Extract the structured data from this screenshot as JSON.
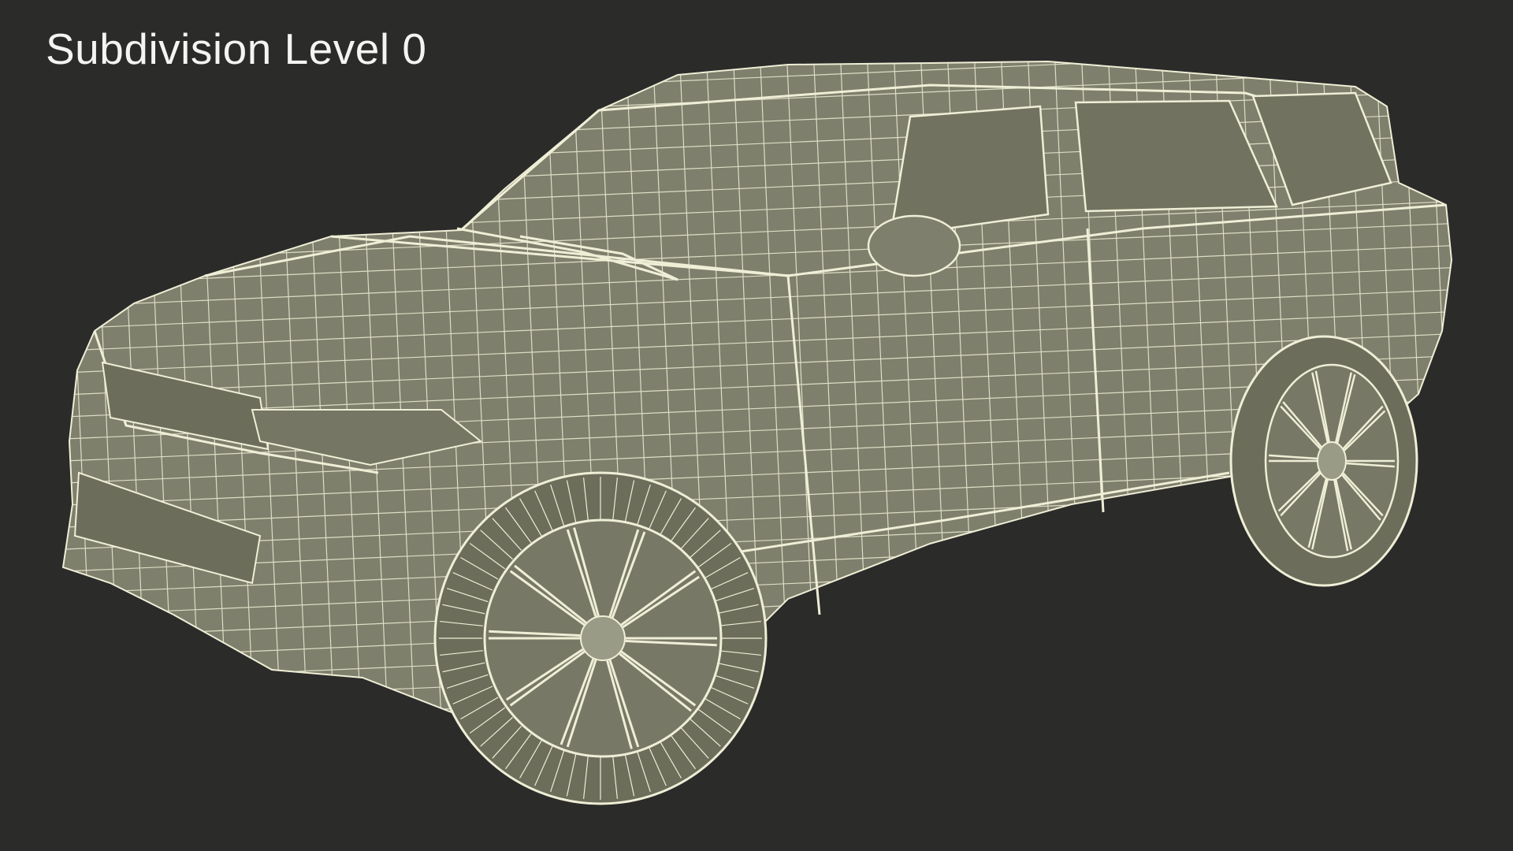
{
  "caption": {
    "text": "Subdivision Level 0"
  },
  "scene": {
    "subject": "suv-wireframe-model",
    "background_color": "#2b2b2a",
    "surface_color": "#7e7f6c",
    "wire_color": "#efeed6"
  }
}
